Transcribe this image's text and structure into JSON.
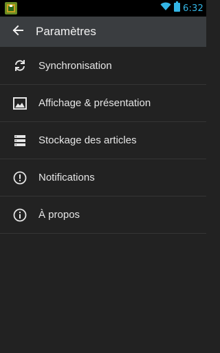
{
  "status_bar": {
    "time": "6:32",
    "notification_icon": "app-notification-icon",
    "wifi_icon": "wifi-icon",
    "battery_icon": "battery-icon",
    "accent_color": "#33b5e5"
  },
  "action_bar": {
    "title": "Paramètres",
    "back_icon": "arrow-left-icon",
    "background": "#3a3d40"
  },
  "settings": {
    "items": [
      {
        "label": "Synchronisation",
        "icon": "sync-icon"
      },
      {
        "label": "Affichage & présentation",
        "icon": "image-icon"
      },
      {
        "label": "Stockage des articles",
        "icon": "storage-icon"
      },
      {
        "label": "Notifications",
        "icon": "alert-icon"
      },
      {
        "label": "À propos",
        "icon": "info-icon"
      }
    ]
  }
}
